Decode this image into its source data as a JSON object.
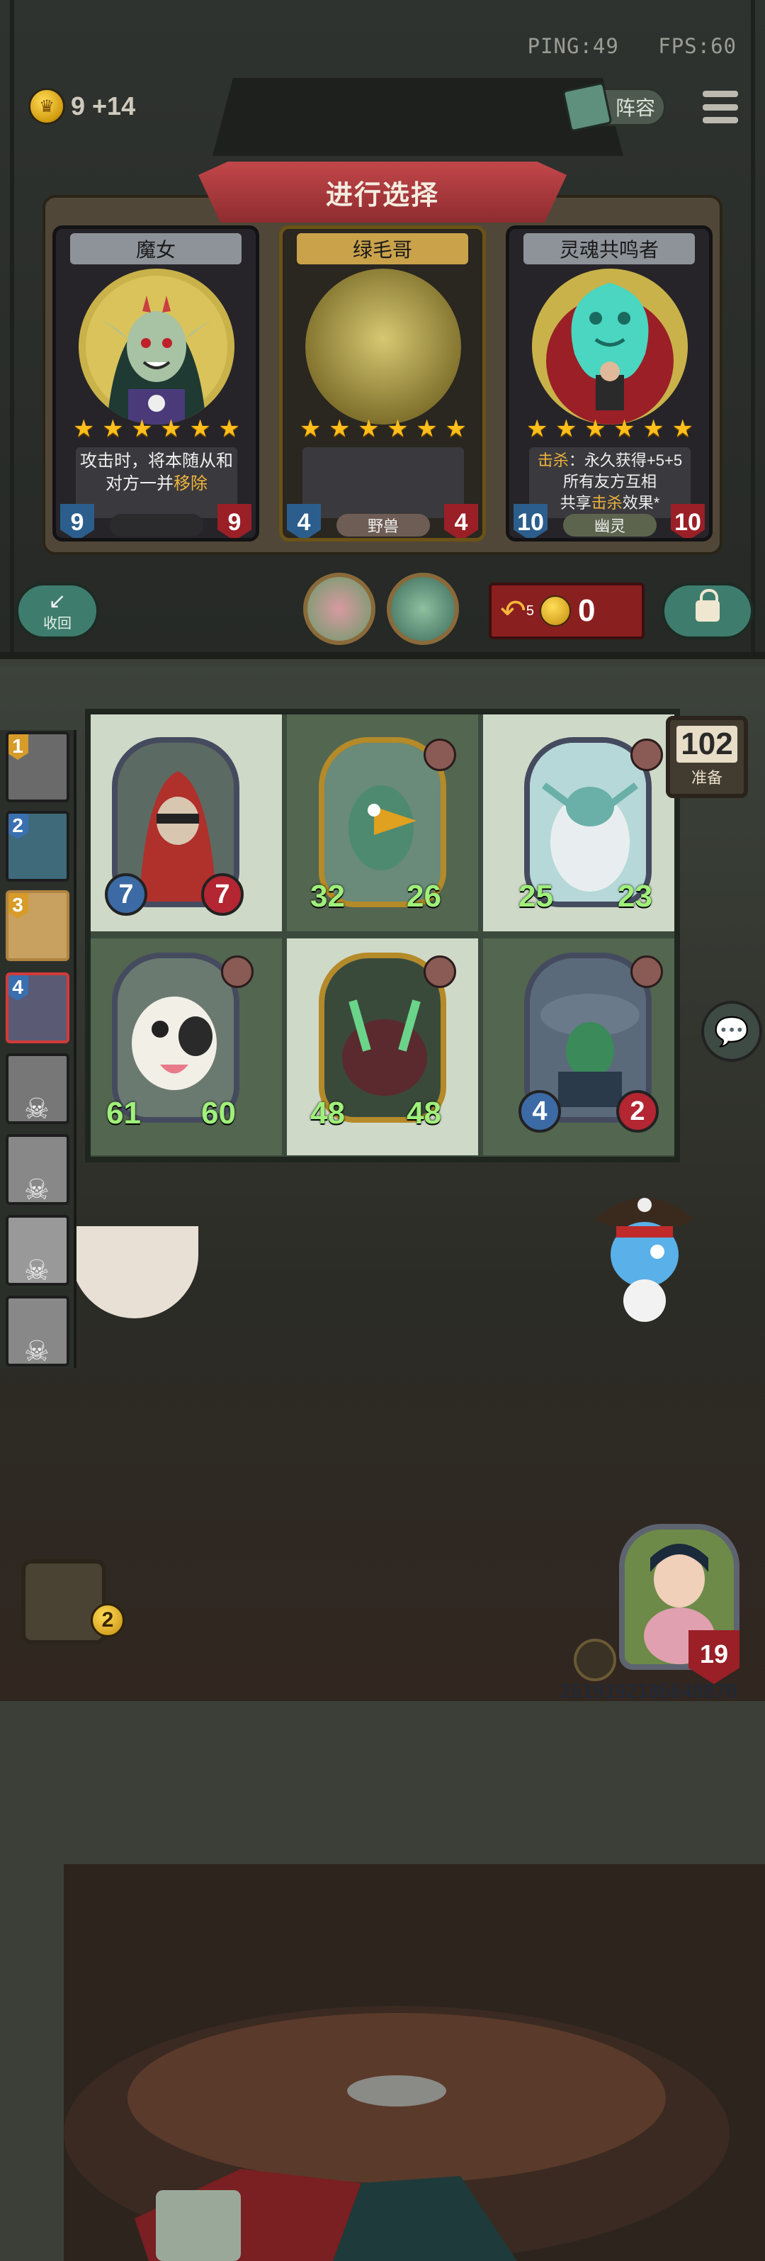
{
  "status": {
    "ping": "PING:49",
    "fps": "FPS:60"
  },
  "gold": {
    "text": "9 +14"
  },
  "lineup_button": {
    "label": "阵容"
  },
  "choice": {
    "title": "进行选择",
    "cards": [
      {
        "name": "魔女",
        "stars": 6,
        "text_pre": "攻击时，将本随从和对方一并",
        "text_hl": "移除",
        "attack": "9",
        "health": "9",
        "tribe": ""
      },
      {
        "name": "绿毛哥",
        "stars": 6,
        "text_pre": "",
        "text_hl": "",
        "attack": "4",
        "health": "4",
        "tribe": "野兽"
      },
      {
        "name": "灵魂共鸣者",
        "stars": 6,
        "line1_hl": "击杀",
        "line1": "：永久获得+5+5",
        "line2": "所有友方互相",
        "line3_pre": "共享",
        "line3_hl": "击杀",
        "line3_post": "效果*",
        "attack": "10",
        "health": "10",
        "tribe": "幽灵"
      }
    ]
  },
  "recall_button": {
    "label": "收回"
  },
  "refresh": {
    "cost": "5",
    "gold": "0"
  },
  "timer": {
    "value": "102",
    "label": "准备"
  },
  "board": {
    "minions": [
      {
        "attack": "7",
        "health": "7",
        "golden": false
      },
      {
        "attack": "32",
        "health": "26",
        "golden": true
      },
      {
        "attack": "25",
        "health": "23",
        "golden": false
      },
      {
        "attack": "61",
        "health": "60",
        "golden": false
      },
      {
        "attack": "48",
        "health": "48",
        "golden": true
      },
      {
        "attack": "4",
        "health": "2",
        "golden": false
      }
    ]
  },
  "players": [
    {
      "rank": "1",
      "color": "#d79b2a"
    },
    {
      "rank": "2",
      "color": "#3a6fb0"
    },
    {
      "rank": "3",
      "color": "#d79b2a"
    },
    {
      "rank": "4",
      "color": "#3a6fb0"
    }
  ],
  "tavern_tier": "2",
  "hero": {
    "health": "19"
  },
  "uid": "2619192186648870"
}
